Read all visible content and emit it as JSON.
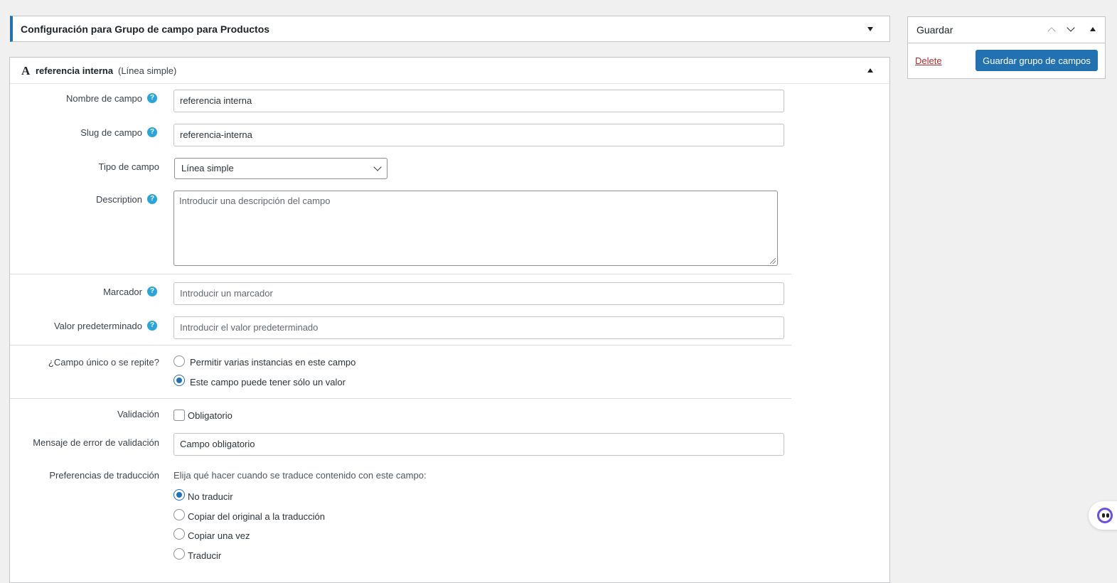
{
  "config_box": {
    "title": "Configuración para Grupo de campo para Productos"
  },
  "field": {
    "type_glyph": "A",
    "name": "referencia interna",
    "type_label": "(Línea simple)"
  },
  "form": {
    "help_glyph": "?",
    "name_label": "Nombre de campo",
    "name_value": "referencia interna",
    "slug_label": "Slug de campo",
    "slug_value": "referencia-interna",
    "type_label": "Tipo de campo",
    "type_value": "Línea simple",
    "description_label": "Description",
    "description_placeholder": "Introducir una descripción del campo",
    "placeholder_label": "Marcador",
    "placeholder_placeholder": "Introducir un marcador",
    "default_label": "Valor predeterminado",
    "default_placeholder": "Introducir el valor predeterminado",
    "repeat_label": "¿Campo único o se repite?",
    "repeat_options": [
      {
        "label": "Permitir varias instancias en este campo",
        "checked": false
      },
      {
        "label": "Este campo puede tener sólo un valor",
        "checked": true
      }
    ],
    "validation_label": "Validación",
    "required_label": "Obligatorio",
    "required_checked": false,
    "error_label": "Mensaje de error de validación",
    "error_value": "Campo obligatorio",
    "translation_label": "Preferencias de traducción",
    "translation_hint": "Elija qué hacer cuando se traduce contenido con este campo:",
    "translation_options": [
      {
        "label": "No traducir",
        "checked": true
      },
      {
        "label": "Copiar del original a la traducción",
        "checked": false
      },
      {
        "label": "Copiar una vez",
        "checked": false
      },
      {
        "label": "Traducir",
        "checked": false
      }
    ]
  },
  "save_box": {
    "title": "Guardar",
    "delete_label": "Delete",
    "save_label": "Guardar grupo de campos"
  },
  "colors": {
    "accent": "#2271b1",
    "help": "#2aa5da",
    "delete": "#b32d2e"
  }
}
